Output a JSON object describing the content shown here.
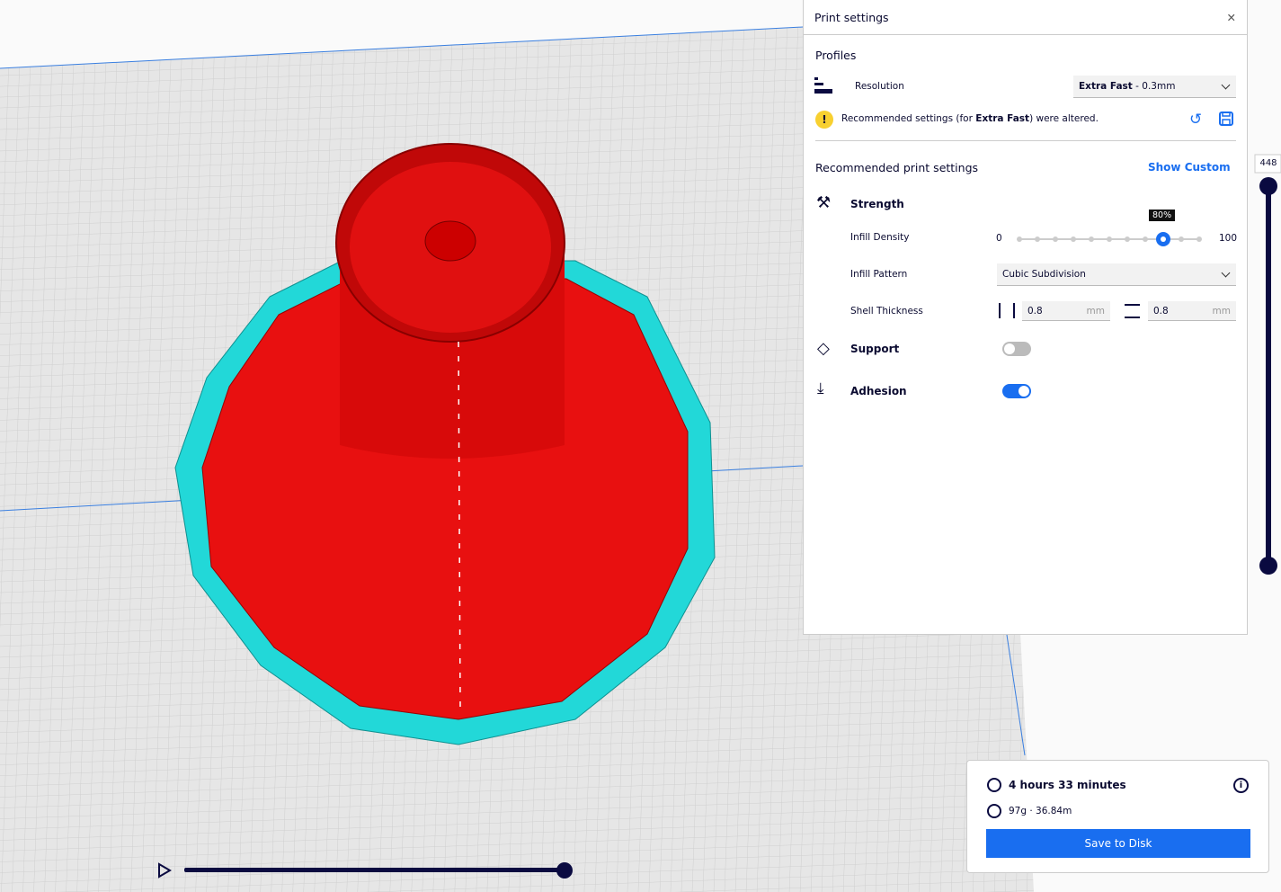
{
  "panel": {
    "title": "Print settings",
    "profiles_label": "Profiles",
    "resolution_label": "Resolution",
    "resolution_value_bold": "Extra Fast",
    "resolution_value_rest": " - 0.3mm",
    "warning_pre": "Recommended settings (for ",
    "warning_bold": "Extra Fast",
    "warning_post": ") were altered.",
    "recommended_label": "Recommended print settings",
    "show_custom": "Show Custom",
    "strength": "Strength",
    "infill_density_label": "Infill Density",
    "infill_min": "0",
    "infill_max": "100",
    "infill_value": 80,
    "infill_tooltip": "80%",
    "infill_pattern_label": "Infill Pattern",
    "infill_pattern_value": "Cubic Subdivision",
    "shell_label": "Shell Thickness",
    "shell_wall": "0.8",
    "shell_top": "0.8",
    "unit": "mm",
    "support": "Support",
    "support_on": false,
    "adhesion": "Adhesion",
    "adhesion_on": true
  },
  "layer_slider": {
    "value": "448"
  },
  "estimate": {
    "time": "4 hours 33 minutes",
    "material": "97g · 36.84m",
    "save": "Save to Disk"
  },
  "colors": {
    "accent": "#196ef0",
    "model": "#ee1111",
    "skirt": "#22d8d8",
    "dark": "#0a0a40"
  }
}
